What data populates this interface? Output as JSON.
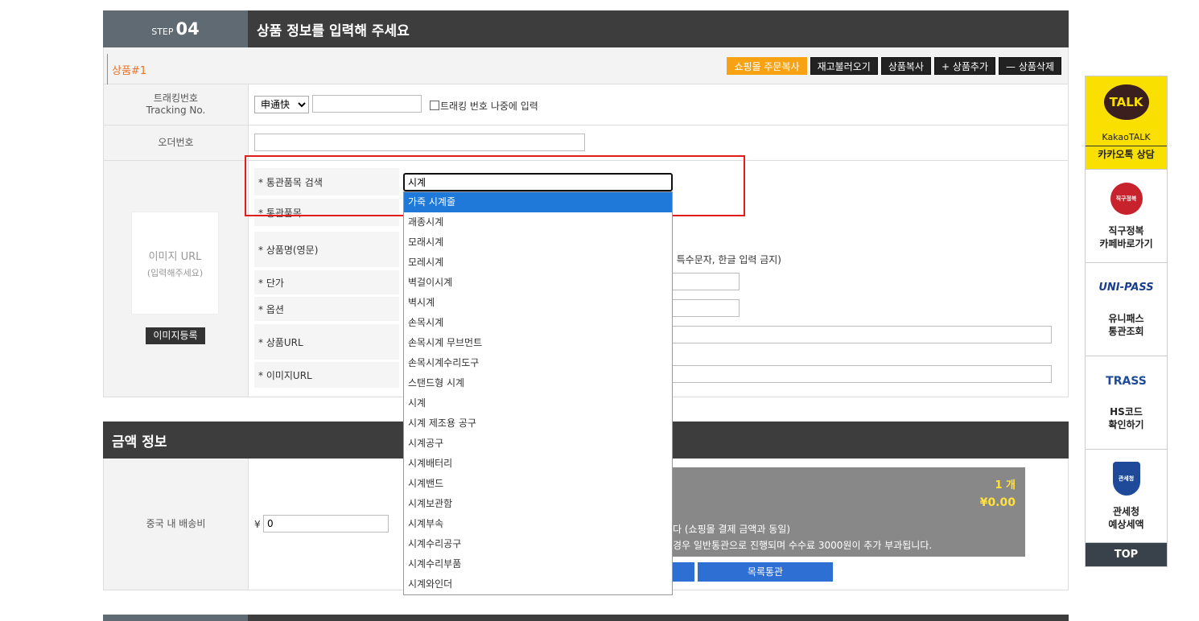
{
  "step": {
    "small": "STEP",
    "num": "04",
    "title": "상품 정보를 입력해 주세요"
  },
  "subbar": {
    "tab": "상품#1",
    "buttons": [
      "쇼핑몰 주문복사",
      "재고불러오기",
      "상품복사",
      "+ 상품추가",
      "— 상품삭제"
    ]
  },
  "tracking": {
    "label1": "트래킹번호",
    "label2": "Tracking No.",
    "carrier": "申通快",
    "checkbox_label": "트래킹 번호 나중에 입력"
  },
  "order": {
    "label": "오더번호"
  },
  "image": {
    "t1": "이미지 URL",
    "t2": "(입력해주세요)",
    "button": "이미지등록"
  },
  "fields": {
    "customs_search": "* 통관품목 검색",
    "customs_item": "* 통관품목",
    "name_en": "* 상품명(영문)",
    "name_en_note": ", 특수문자, 한글 입력 금지)",
    "price": "* 단가",
    "option": "* 옵션",
    "url": "* 상품URL",
    "img_url": "* 이미지URL"
  },
  "search": {
    "value": "시계"
  },
  "dropdown": [
    "가죽 시계줄",
    "괘종시계",
    "모래시계",
    "모레시계",
    "벽걸이시계",
    "벽시계",
    "손목시계",
    "손목시계 무브먼트",
    "손목시계수리도구",
    "스탠드형 시계",
    "시계",
    "시계 제조용 공구",
    "시계공구",
    "시계배터리",
    "시계밴드",
    "시계보관함",
    "시계부속",
    "시계수리공구",
    "시계수리부품",
    "시계와인더"
  ],
  "amount": {
    "title": "금액 정보",
    "shipping_label": "중국 내 배송비",
    "currency": "¥",
    "shipping_value": "0",
    "count": "1 개",
    "total": "¥0.00",
    "note1": "다 (쇼핑몰 결제 금액과 동일)",
    "note2": "경우 일반통관으로 진행되며 수수료 3000원이 추가 부과됩니다.",
    "list_btn": "목록통관"
  },
  "side": {
    "kakao1": "KakaoTALK",
    "kakao2": "카카오톡 상담",
    "kakao_logo": "TALK",
    "jikgu_logo": "직구정복",
    "jikgu1": "직구정복",
    "jikgu2": "카페바로가기",
    "unipass_logo": "UNI-PASS",
    "unipass1": "유니패스",
    "unipass2": "통관조회",
    "trass_logo": "TRASS",
    "hs1": "HS코드",
    "hs2": "확인하기",
    "customs_logo": "관세청",
    "customs1": "관세청",
    "customs2": "예상세액",
    "top": "TOP"
  }
}
